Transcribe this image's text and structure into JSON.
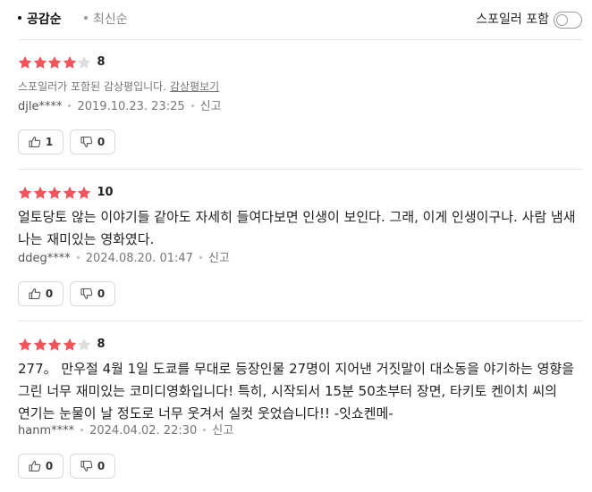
{
  "sort": {
    "active_label": "공감순",
    "inactive_label": "최신순"
  },
  "spoiler_toggle": {
    "label": "스포일러 포함",
    "on": false
  },
  "colors": {
    "star_filled": "#f2545b",
    "star_empty": "#dddddd"
  },
  "reviews": [
    {
      "stars": 4,
      "score": "8",
      "spoiler_notice": "스포일러가 포함된 감상평입니다.",
      "spoiler_link": "감상평보기",
      "text": "",
      "user": "djle****",
      "date": "2019.10.23. 23:25",
      "report": "신고",
      "likes": "1",
      "dislikes": "0"
    },
    {
      "stars": 5,
      "score": "10",
      "spoiler_notice": "",
      "spoiler_link": "",
      "text": "얼토당토 않는 이야기들 같아도 자세히 들여다보면 인생이 보인다. 그래, 이게 인생이구나. 사람 냄새 나는 재미있는 영화였다.",
      "user": "ddeg****",
      "date": "2024.08.20. 01:47",
      "report": "신고",
      "likes": "0",
      "dislikes": "0"
    },
    {
      "stars": 4,
      "score": "8",
      "spoiler_notice": "",
      "spoiler_link": "",
      "text": "277。 만우절 4월 1일 도쿄를 무대로 등장인물 27명이 지어낸 거짓말이 대소동을 야기하는 영향을 그린 너무 재미있는 코미디영화입니다! 특히, 시작되서 15분 50초부터 장면, 타키토 켄이치 씨의 연기는 눈물이 날 정도로 너무 웃겨서 실컷 웃었습니다!! -잇쇼켄메-",
      "user": "hanm****",
      "date": "2024.04.02. 22:30",
      "report": "신고",
      "likes": "0",
      "dislikes": "0"
    }
  ]
}
